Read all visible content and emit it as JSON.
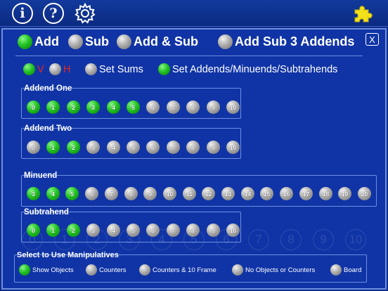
{
  "toolbar": {
    "info_label": "i",
    "help_label": "?",
    "gear_icon": "gear-icon",
    "puzzle_icon": "puzzle-piece-icon",
    "puzzle_color": "#f2e11a"
  },
  "close_label": "X",
  "modes": [
    {
      "label": "Add",
      "selected": true
    },
    {
      "label": "Sub",
      "selected": false
    },
    {
      "label": "Add & Sub",
      "selected": false
    },
    {
      "label": "Add Sub 3 Addends",
      "selected": false
    }
  ],
  "options": {
    "v_label": "V",
    "v_selected": true,
    "h_label": "H",
    "h_selected": false,
    "set_sums_label": "Set Sums",
    "set_sums_selected": false,
    "set_addends_label": "Set Addends/Minuends/Subtrahends",
    "set_addends_selected": true,
    "vh_label_color": "#e8261a"
  },
  "groups": {
    "addend_one": {
      "label": "Addend One",
      "numbers": [
        "0",
        "1",
        "2",
        "3",
        "4",
        "5",
        "6",
        "7",
        "8",
        "9",
        "10"
      ],
      "selected": [
        true,
        true,
        true,
        true,
        true,
        true,
        false,
        false,
        false,
        false,
        false
      ]
    },
    "addend_two": {
      "label": "Addend Two",
      "numbers": [
        "0",
        "1",
        "2",
        "3",
        "4",
        "5",
        "6",
        "7",
        "8",
        "9",
        "10"
      ],
      "selected": [
        false,
        true,
        true,
        false,
        false,
        false,
        false,
        false,
        false,
        false,
        false
      ]
    },
    "minuend": {
      "label": "Minuend",
      "numbers": [
        "3",
        "4",
        "5",
        "6",
        "7",
        "8",
        "9",
        "10",
        "11",
        "12",
        "13",
        "14",
        "15",
        "16",
        "17",
        "18",
        "19",
        "20"
      ],
      "selected": [
        true,
        true,
        true,
        false,
        false,
        false,
        false,
        false,
        false,
        false,
        false,
        false,
        false,
        false,
        false,
        false,
        false,
        false
      ]
    },
    "subtrahend": {
      "label": "Subtrahend",
      "numbers": [
        "0",
        "1",
        "2",
        "3",
        "4",
        "5",
        "6",
        "7",
        "8",
        "9",
        "10"
      ],
      "selected": [
        true,
        true,
        true,
        false,
        false,
        false,
        false,
        false,
        false,
        false,
        false
      ]
    }
  },
  "background_numbers": [
    "0",
    "1",
    "2",
    "3",
    "4",
    "5",
    "6",
    "7",
    "8",
    "9",
    "10"
  ],
  "manipulatives": {
    "title": "Select to Use Manipulatives",
    "options": [
      {
        "label": "Show Objects",
        "selected": true
      },
      {
        "label": "Counters",
        "selected": false
      },
      {
        "label": "Counters & 10 Frame",
        "selected": false
      },
      {
        "label": "No Objects or Counters",
        "selected": false
      },
      {
        "label": "Board",
        "selected": false
      }
    ]
  }
}
